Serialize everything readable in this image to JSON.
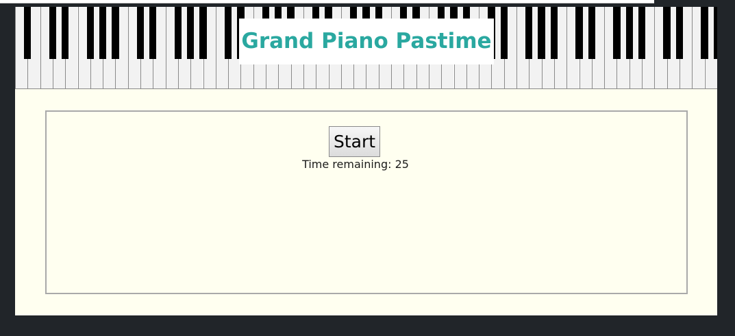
{
  "header": {
    "title": "Grand Piano Pastime"
  },
  "game": {
    "start_label": "Start",
    "timer_label": "Time remaining:",
    "time_remaining": "25"
  },
  "colors": {
    "title": "#2aa8a0",
    "content_background": "#fffff0",
    "page_background": "#212529"
  }
}
